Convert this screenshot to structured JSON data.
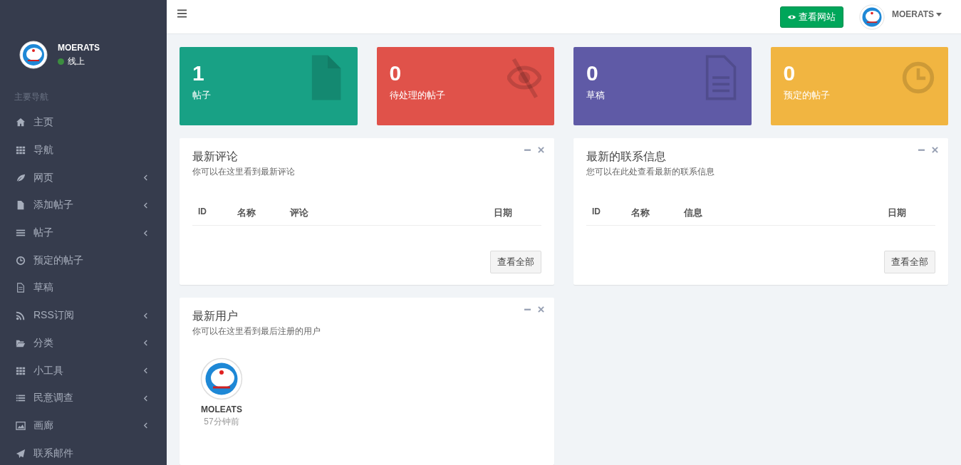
{
  "sidebar": {
    "user": {
      "name": "MOERATS",
      "status": "线上",
      "online": true
    },
    "section_label": "主要导航",
    "items": [
      {
        "label": "主页",
        "has_submenu": false
      },
      {
        "label": "导航",
        "has_submenu": false
      },
      {
        "label": "网页",
        "has_submenu": true
      },
      {
        "label": "添加帖子",
        "has_submenu": true
      },
      {
        "label": "帖子",
        "has_submenu": true
      },
      {
        "label": "预定的帖子",
        "has_submenu": false
      },
      {
        "label": "草稿",
        "has_submenu": false
      },
      {
        "label": "RSS订阅",
        "has_submenu": true
      },
      {
        "label": "分类",
        "has_submenu": true
      },
      {
        "label": "小工具",
        "has_submenu": true
      },
      {
        "label": "民意调查",
        "has_submenu": true
      },
      {
        "label": "画廊",
        "has_submenu": true
      },
      {
        "label": "联系邮件",
        "has_submenu": false
      }
    ]
  },
  "header": {
    "view_site_button": "查看网站",
    "user_name": "MOERATS"
  },
  "stats": [
    {
      "value": "1",
      "label": "帖子",
      "color": "#18a185"
    },
    {
      "value": "0",
      "label": "待处理的帖子",
      "color": "#e0524a"
    },
    {
      "value": "0",
      "label": "草稿",
      "color": "#5f5aa6"
    },
    {
      "value": "0",
      "label": "预定的帖子",
      "color": "#f1b541"
    }
  ],
  "panels": [
    {
      "title": "最新评论",
      "subtitle": "你可以在这里看到最新评论",
      "columns": [
        "ID",
        "名称",
        "评论",
        "日期"
      ],
      "button": "查看全部"
    },
    {
      "title": "最新的联系信息",
      "subtitle": "您可以在此处查看最新的联系信息",
      "columns": [
        "ID",
        "名称",
        "信息",
        "日期"
      ],
      "button": "查看全部"
    }
  ],
  "users_panel": {
    "title": "最新用户",
    "subtitle": "你可以在这里看到最后注册的用户",
    "users": [
      {
        "name": "MOLEATS",
        "time": "57分钟前"
      }
    ]
  }
}
